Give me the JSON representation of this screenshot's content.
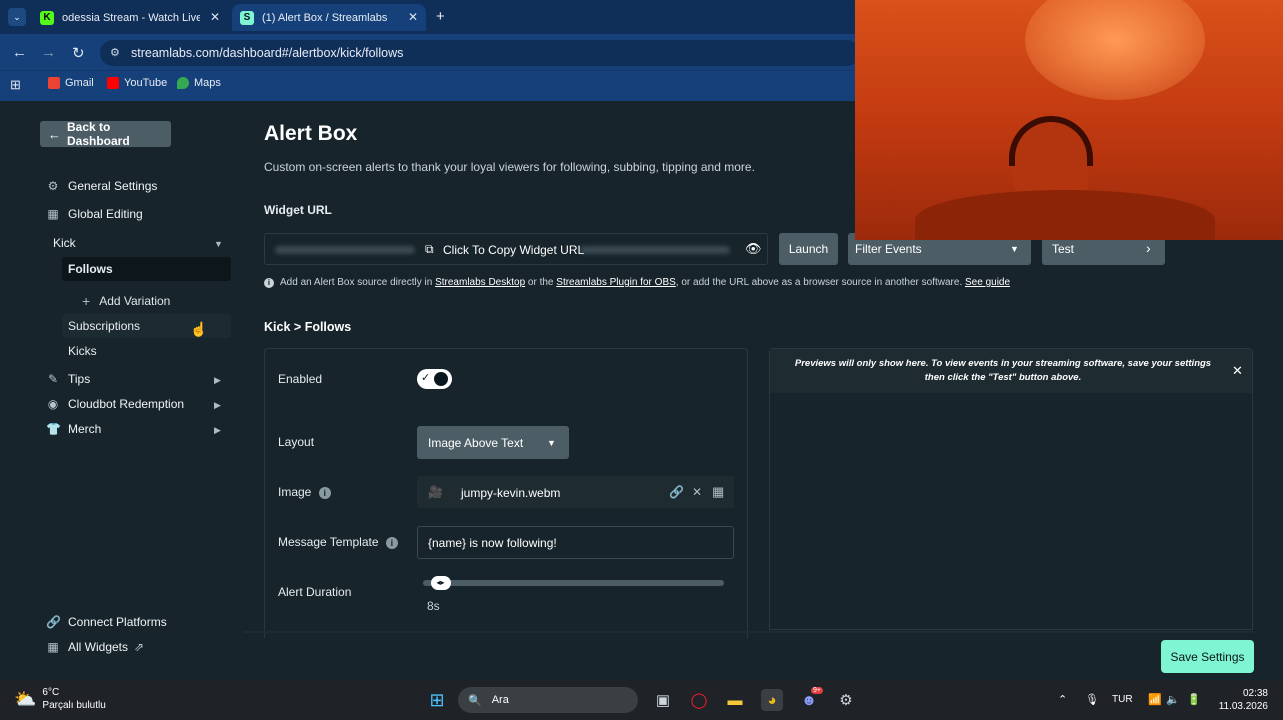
{
  "browser": {
    "tabs": [
      {
        "title": "odessia Stream - Watch Live on",
        "favicon_color": "#53fc18"
      },
      {
        "title": "(1) Alert Box / Streamlabs",
        "favicon_color": "#80f5d2"
      }
    ],
    "url": "streamlabs.com/dashboard#/alertbox/kick/follows",
    "bookmarks": [
      "Gmail",
      "YouTube",
      "Maps"
    ]
  },
  "sidebar": {
    "back_label": "Back to Dashboard",
    "items": [
      {
        "label": "General Settings",
        "icon": "gear-icon"
      },
      {
        "label": "Global Editing",
        "icon": "grid-icon"
      }
    ],
    "kick": {
      "label": "Kick",
      "follows": "Follows",
      "add_variation": "Add Variation",
      "subscriptions": "Subscriptions",
      "kicks": "Kicks"
    },
    "groups": [
      {
        "label": "Tips",
        "icon": "tips-icon"
      },
      {
        "label": "Cloudbot Redemption",
        "icon": "cloudbot-icon"
      },
      {
        "label": "Merch",
        "icon": "shirt-icon"
      }
    ],
    "footer": {
      "connect": "Connect Platforms",
      "widgets": "All Widgets"
    }
  },
  "main": {
    "title": "Alert Box",
    "subtitle": "Custom on-screen alerts to thank your loyal viewers for following, subbing, tipping and more.",
    "widget_url_label": "Widget URL",
    "copy_label": "Click To Copy Widget URL",
    "launch": "Launch",
    "filter_events": "Filter Events",
    "test": "Test",
    "info": {
      "prefix": "Add an Alert Box source directly in",
      "link1": "Streamlabs Desktop",
      "or": "or the",
      "link2": "Streamlabs Plugin for OBS",
      "suffix": ", or add the URL above as a browser source in another software.",
      "guide": "See guide"
    },
    "breadcrumb": {
      "platform": "Kick",
      "sep": ">",
      "event": "Follows"
    },
    "form": {
      "enabled_label": "Enabled",
      "enabled": true,
      "layout_label": "Layout",
      "layout_value": "Image Above Text",
      "image_label": "Image",
      "image_value": "jumpy-kevin.webm",
      "template_label": "Message Template",
      "template_value": "{name} is now following!",
      "duration_label": "Alert Duration",
      "duration_value": "8s",
      "duration_fraction": 0.03
    },
    "preview_note": "Previews will only show here. To view events in your streaming software, save your settings then click the \"Test\" button above.",
    "save": "Save Settings"
  },
  "taskbar": {
    "weather_temp": "6°C",
    "weather_desc": "Parçalı bulutlu",
    "search": "Ara",
    "lang": "TUR",
    "time": "02:38",
    "date": "11.03.2026",
    "discord_badge": "9+"
  },
  "colors": {
    "accent": "#80f5d2",
    "panel": "#17242b",
    "chrome": "#15407a"
  }
}
